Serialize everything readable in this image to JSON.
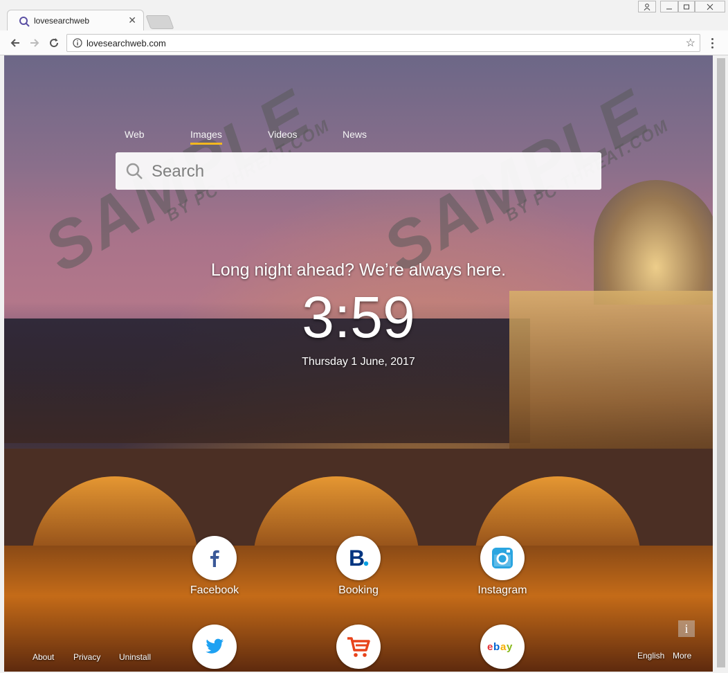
{
  "browser": {
    "tab_title": "lovesearchweb",
    "tab_close": "✕",
    "url": "lovesearchweb.com",
    "bookmark_star": "☆"
  },
  "watermark": {
    "main": "SAMPLE",
    "sub": "BY PC THREAT.COM"
  },
  "search": {
    "tabs": [
      {
        "label": "Web"
      },
      {
        "label": "Images"
      },
      {
        "label": "Videos"
      },
      {
        "label": "News"
      }
    ],
    "active_tab": "Images",
    "placeholder": "Search"
  },
  "hero": {
    "tagline": "Long night ahead? We’re always here.",
    "time": "3:59",
    "date": "Thursday 1 June, 2017"
  },
  "shortcuts": [
    {
      "label": "Facebook",
      "icon": "facebook-icon",
      "color": "#3b5998"
    },
    {
      "label": "Booking",
      "icon": "booking-icon",
      "color": "#003580"
    },
    {
      "label": "Instagram",
      "icon": "instagram-icon",
      "color": "#2aa5e0"
    },
    {
      "label": "",
      "icon": "twitter-icon",
      "color": "#1da1f2"
    },
    {
      "label": "",
      "icon": "cart-icon",
      "color": "#e8431b"
    },
    {
      "label": "",
      "icon": "ebay-icon",
      "color": "#e53238"
    }
  ],
  "footer": {
    "about": "About",
    "privacy": "Privacy",
    "uninstall": "Uninstall",
    "language": "English",
    "more": "More",
    "info": "i"
  },
  "colors": {
    "accent_underline": "#f2b81e"
  }
}
